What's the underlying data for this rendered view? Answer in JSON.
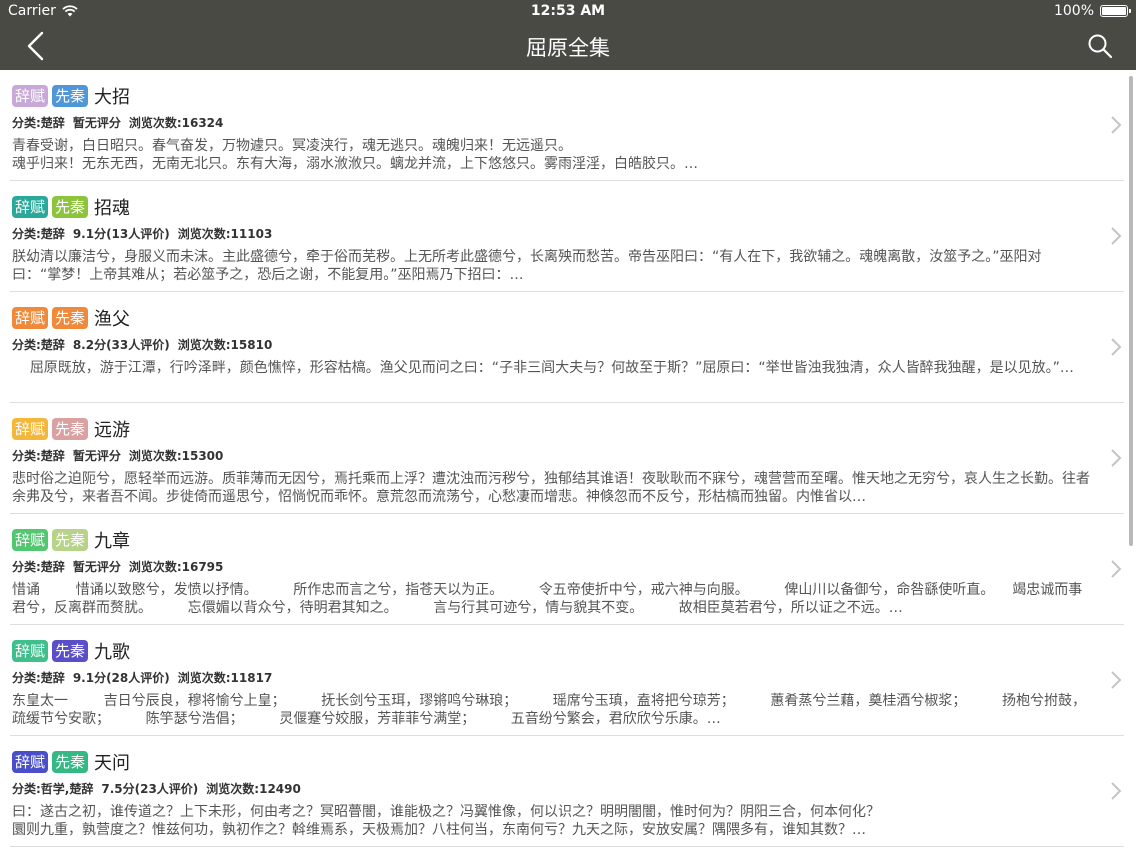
{
  "status_bar": {
    "carrier": "Carrier",
    "time": "12:53 AM",
    "battery": "100%"
  },
  "nav": {
    "title": "屈原全集"
  },
  "items": [
    {
      "tags": [
        {
          "label": "辞赋",
          "color": "#c7a8d9"
        },
        {
          "label": "先秦",
          "color": "#4f97d6"
        }
      ],
      "title": "大招",
      "category": "分类:楚辞",
      "rating": "暂无评分",
      "views": "浏览次数:16324",
      "excerpt": "青春受谢，白日昭只。春气奋发，万物遽只。冥凌浃行，魂无逃只。魂魄归来！无远遥只。\n魂乎归来！无东无西，无南无北只。东有大海，溺水浟浟只。螭龙并流，上下悠悠只。雾雨淫淫，白皓胶只。…"
    },
    {
      "tags": [
        {
          "label": "辞赋",
          "color": "#2aa99a"
        },
        {
          "label": "先秦",
          "color": "#8cc43e"
        }
      ],
      "title": "招魂",
      "category": "分类:楚辞",
      "rating": "9.1分(13人评价)",
      "views": "浏览次数:11103",
      "excerpt": "朕幼清以廉洁兮，身服义而未沫。主此盛德兮，牵于俗而芜秽。上无所考此盛德兮，长离殃而愁苦。帝告巫阳曰：“有人在下，我欲辅之。魂魄离散，汝筮予之。”巫阳对曰：“掌梦！上帝其难从；若必筮予之，恐后之谢，不能复用。”巫阳焉乃下招曰：…"
    },
    {
      "tags": [
        {
          "label": "辞赋",
          "color": "#f08a3a"
        },
        {
          "label": "先秦",
          "color": "#f08a3a"
        }
      ],
      "title": "渔父",
      "category": "分类:楚辞",
      "rating": "8.2分(33人评价)",
      "views": "浏览次数:15810",
      "excerpt": "    屈原既放，游于江潭，行吟泽畔，颜色憔悴，形容枯槁。渔父见而问之曰：“子非三闾大夫与？何故至于斯？”屈原曰：“举世皆浊我独清，众人皆醉我独醒，是以见放。”…"
    },
    {
      "tags": [
        {
          "label": "辞赋",
          "color": "#f5b73b"
        },
        {
          "label": "先秦",
          "color": "#d9a1a1"
        }
      ],
      "title": "远游",
      "category": "分类:楚辞",
      "rating": "暂无评分",
      "views": "浏览次数:15300",
      "excerpt": "悲时俗之迫阨兮，愿轻举而远游。质菲薄而无因兮，焉托乘而上浮？遭沈浊而污秽兮，独郁结其谁语！夜耿耿而不寐兮，魂营营而至曙。惟天地之无穷兮，哀人生之长勤。往者余弗及兮，来者吾不闻。步徙倚而遥思兮，怊惝怳而乖怀。意荒忽而流荡兮，心愁凄而增悲。神倏忽而不反兮，形枯槁而独留。内惟省以…"
    },
    {
      "tags": [
        {
          "label": "辞赋",
          "color": "#52c76f"
        },
        {
          "label": "先秦",
          "color": "#b7d38a"
        }
      ],
      "title": "九章",
      "category": "分类:楚辞",
      "rating": "暂无评分",
      "views": "浏览次数:16795",
      "excerpt": "惜诵        惜诵以致愍兮，发愤以抒情。        所作忠而言之兮，指苍天以为正。        令五帝使折中兮，戒六神与向服。        俾山川以备御兮，命咎繇使听直。    竭忠诚而事君兮，反离群而赘肬。        忘儇媚以背众兮，待明君其知之。        言与行其可迹兮，情与貌其不变。        故相臣莫若君兮，所以证之不远。…"
    },
    {
      "tags": [
        {
          "label": "辞赋",
          "color": "#3fbf8c"
        },
        {
          "label": "先秦",
          "color": "#5b4fc9"
        }
      ],
      "title": "九歌",
      "category": "分类:楚辞",
      "rating": "9.1分(28人评价)",
      "views": "浏览次数:11817",
      "excerpt": "东皇太一        吉日兮辰良，穆将愉兮上皇；        抚长剑兮玉珥，璆锵鸣兮琳琅；        瑶席兮玉瑱，盍将把兮琼芳；        蕙肴蒸兮兰藉，奠桂酒兮椒浆；        扬枹兮拊鼓，疏缓节兮安歌；        陈竽瑟兮浩倡；        灵偃蹇兮姣服，芳菲菲兮满堂；        五音纷兮繁会，君欣欣兮乐康。…"
    },
    {
      "tags": [
        {
          "label": "辞赋",
          "color": "#4a4fc9"
        },
        {
          "label": "先秦",
          "color": "#34b884"
        }
      ],
      "title": "天问",
      "category": "分类:哲学,楚辞",
      "rating": "7.5分(23人评价)",
      "views": "浏览次数:12490",
      "excerpt": "曰：遂古之初，谁传道之？上下未形，何由考之？冥昭瞢闇，谁能极之？冯翼惟像，何以识之？明明闇闇，惟时何为？阴阳三合，何本何化？\n圜则九重，孰营度之？惟兹何功，孰初作之？斡维焉系，天极焉加？八柱何当，东南何亏？九天之际，安放安属？隅隈多有，谁知其数？…"
    }
  ]
}
